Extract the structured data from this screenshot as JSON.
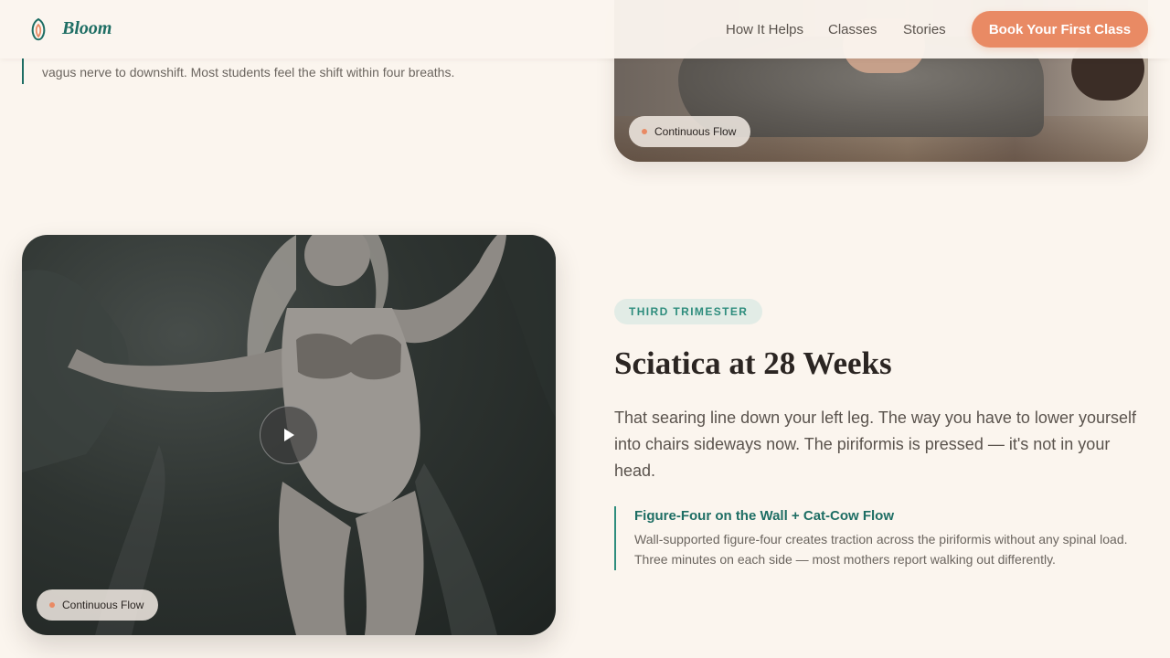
{
  "nav": {
    "brand": "Bloom",
    "links": [
      "How It Helps",
      "Classes",
      "Stories"
    ],
    "cta": "Book Your First Class"
  },
  "previous_section": {
    "tip_tail": "vagus nerve to downshift. Most students feel the shift within four breaths.",
    "chip": "Continuous Flow"
  },
  "section": {
    "badge": "THIRD TRIMESTER",
    "title": "Sciatica at 28 Weeks",
    "lead": "That searing line down your left leg. The way you have to lower yourself into chairs sideways now. The piriformis is pressed — it's not in your head.",
    "tip_title": "Figure-Four on the Wall + Cat-Cow Flow",
    "tip_body": "Wall-supported figure-four creates traction across the piriformis without any spinal load. Three minutes on each side — most mothers report walking out differently.",
    "chip": "Continuous Flow"
  },
  "colors": {
    "background": "#fbf5ee",
    "brand": "#1e6e64",
    "accent": "#e98a64",
    "badge_bg": "#e2ece6"
  },
  "icons": {
    "logo": "bloom-logo-icon",
    "play": "play-icon",
    "chip_dot": "dot-icon"
  }
}
